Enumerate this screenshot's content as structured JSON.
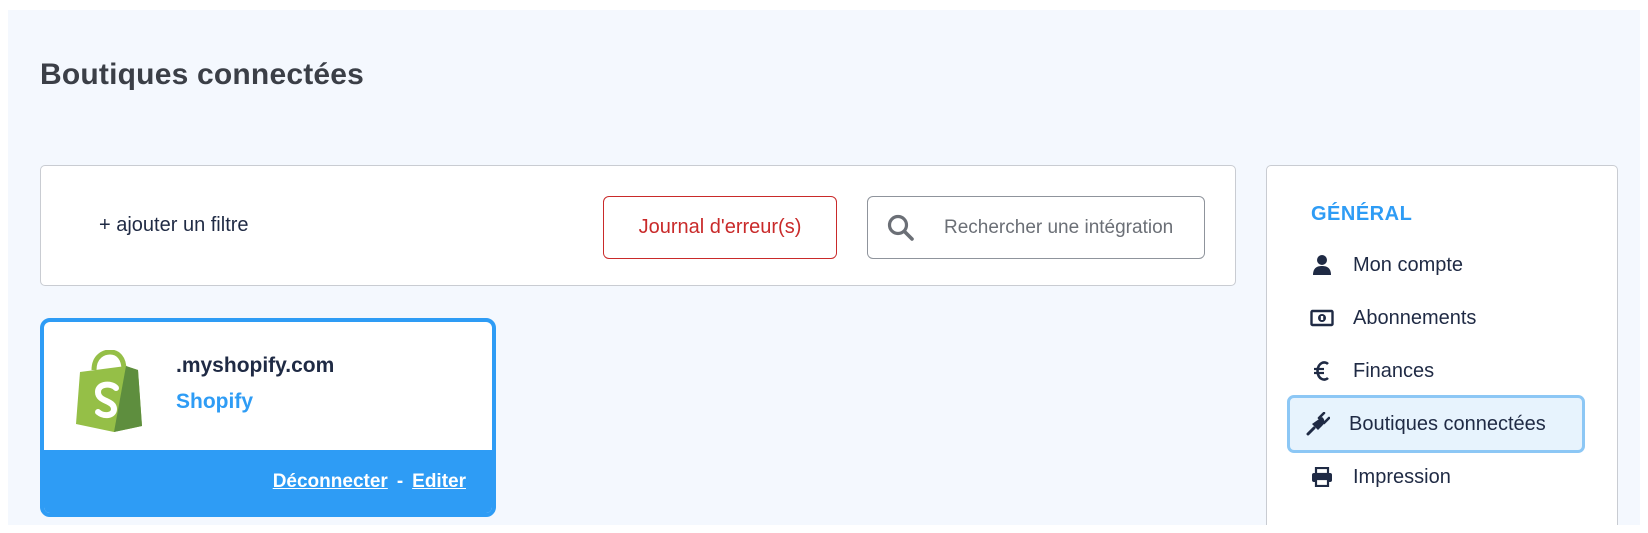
{
  "page": {
    "title": "Boutiques connectées"
  },
  "filter_bar": {
    "add_filter_label": "+ ajouter un filtre",
    "error_log_label": "Journal d'erreur(s)",
    "search_placeholder": "Rechercher une intégration"
  },
  "store_card": {
    "domain": ".myshopify.com",
    "platform": "Shopify",
    "disconnect_label": "Déconnecter",
    "separator": "-",
    "edit_label": "Editer",
    "logo": "shopify-bag-icon"
  },
  "sidebar": {
    "heading": "GÉNÉRAL",
    "items": [
      {
        "label": "Mon compte",
        "icon": "user-icon"
      },
      {
        "label": "Abonnements",
        "icon": "money-bill-icon"
      },
      {
        "label": "Finances",
        "icon": "euro-icon"
      },
      {
        "label": "Boutiques connectées",
        "icon": "plug-icon",
        "active": true
      },
      {
        "label": "Impression",
        "icon": "printer-icon"
      }
    ]
  },
  "colors": {
    "accent": "#2e9cf5",
    "error": "#c92a2a",
    "background": "#f4f8fe",
    "shopify_green": "#95bf47"
  }
}
